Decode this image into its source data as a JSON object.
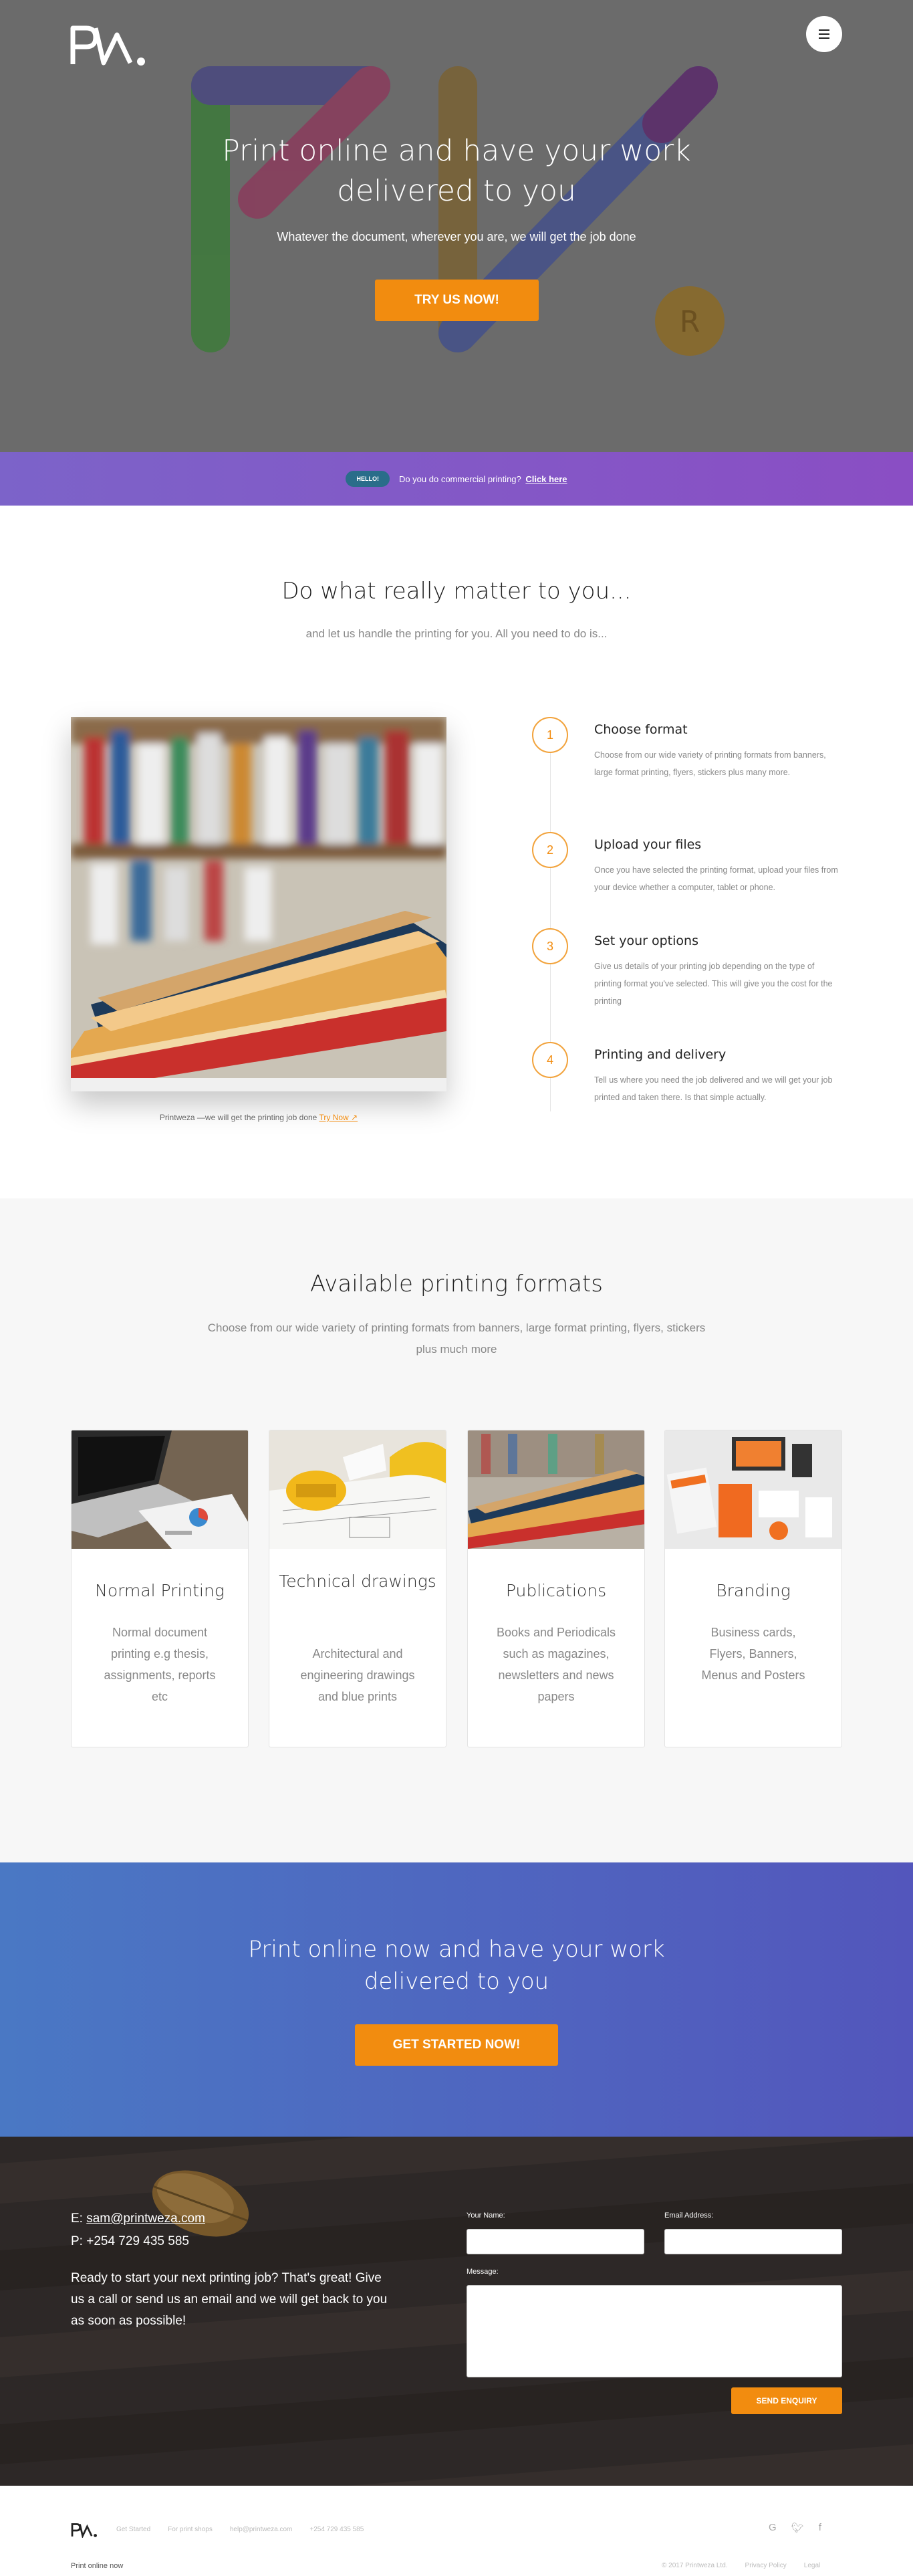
{
  "hero": {
    "title": "Print online and have your work delivered to you",
    "subtitle": "Whatever the document, wherever you are, we will get the job done",
    "cta_label": "TRY US NOW!",
    "bubble_letter": "R"
  },
  "promo": {
    "badge": "HELLO!",
    "text": "Do you do commercial printing?",
    "link": "Click here"
  },
  "steps_section": {
    "title": "Do what really matter to you...",
    "subtitle": "and let us handle the printing for you. All you need to do is...",
    "caption_text": "Printweza —we will get the printing job done",
    "caption_link": "Try Now ↗",
    "steps": [
      {
        "num": "1",
        "title": "Choose format",
        "desc": "Choose from our wide variety of printing formats from banners, large format printing, flyers, stickers plus many more."
      },
      {
        "num": "2",
        "title": "Upload your files",
        "desc": "Once you have selected the printing format, upload your files from your device whether a computer, tablet or phone."
      },
      {
        "num": "3",
        "title": "Set your options",
        "desc": "Give us details of your printing job depending on the type of printing format you've selected. This will give you the cost for the printing"
      },
      {
        "num": "4",
        "title": "Printing and delivery",
        "desc": "Tell us where you need the job delivered and we will get your job printed and taken there. Is that simple actually."
      }
    ]
  },
  "formats_section": {
    "title": "Available printing formats",
    "subtitle": "Choose from our wide variety of printing formats from banners, large format printing, flyers, stickers plus much more",
    "cards": [
      {
        "title": "Normal Printing",
        "desc": "Normal document printing e.g thesis, assignments, reports etc"
      },
      {
        "title": "Technical drawings",
        "desc": "Architectural and engineering drawings and  blue prints"
      },
      {
        "title": "Publications",
        "desc": "Books and Periodicals such as magazines, newsletters and news papers"
      },
      {
        "title": "Branding",
        "desc": "Business cards, Flyers, Banners, Menus and Posters"
      }
    ]
  },
  "cta": {
    "title": "Print online now and have your work delivered to you",
    "button": "GET STARTED NOW!"
  },
  "contact": {
    "email_prefix": "E:",
    "email": "sam@printweza.com",
    "phone": "P: +254 729 435 585",
    "pitch": "Ready to start your next printing job? That's great! Give us a call or send us an email and we will get back to you as soon as possible!",
    "name_label": "Your Name:",
    "email_label": "Email Address:",
    "message_label": "Message:",
    "send_button": "SEND ENQUIRY"
  },
  "footer": {
    "nav": [
      "Get Started",
      "For print shops",
      "help@printweza.com",
      "+254 729 435 585"
    ],
    "tagline": "Print online now",
    "copyright": "© 2017 Printweza Ltd.",
    "privacy": "Privacy Policy",
    "legal": "Legal",
    "social": [
      "google-icon",
      "twitter-icon",
      "facebook-icon"
    ]
  },
  "colors": {
    "accent": "#f28c0f",
    "hero_overlay": "#6b6b6b",
    "promo_gradient_start": "#7c63c9",
    "promo_gradient_end": "#8a4ec4",
    "cta_gradient_start": "#4a78c4",
    "cta_gradient_end": "#5356bc"
  }
}
